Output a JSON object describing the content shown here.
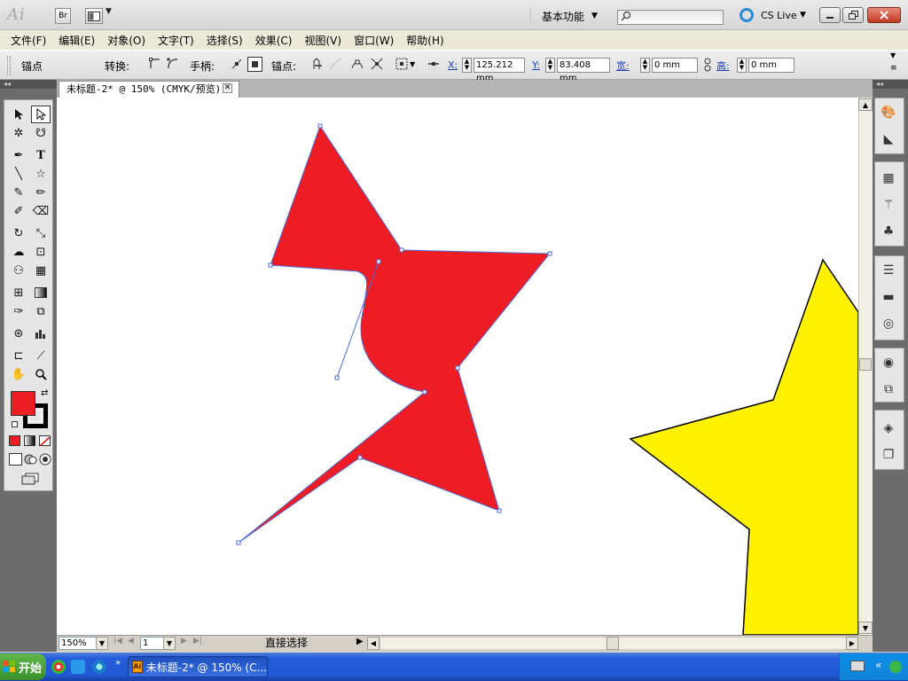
{
  "app": {
    "logo": "Ai",
    "bridge_btn": "Br",
    "workspace_label": "基本功能",
    "cslive_label": "CS Live"
  },
  "menu": [
    "文件(F)",
    "编辑(E)",
    "对象(O)",
    "文字(T)",
    "选择(S)",
    "效果(C)",
    "视图(V)",
    "窗口(W)",
    "帮助(H)"
  ],
  "control": {
    "anchor_label": "锚点",
    "convert_label": "转换:",
    "handles_label": "手柄:",
    "anchors_label": "锚点:",
    "x_label": "X:",
    "x_value": "125.212 mm",
    "y_label": "Y:",
    "y_value": "83.408 mm",
    "w_label": "宽:",
    "w_value": "0 mm",
    "h_label": "高:",
    "h_value": "0 mm"
  },
  "document": {
    "tab_title": "未标题-2* @ 150% (CMYK/预览)",
    "zoom": "150%",
    "page": "1",
    "status_tool": "直接选择"
  },
  "colors": {
    "fill": "#ee1c25",
    "stroke": "#000000",
    "red_shape": "#ee1c25",
    "yellow_star": "#fff200",
    "path_blue": "#4a6fd6"
  },
  "taskbar": {
    "start_label": "开始",
    "task_label": "未标题-2* @ 150% (C..."
  }
}
